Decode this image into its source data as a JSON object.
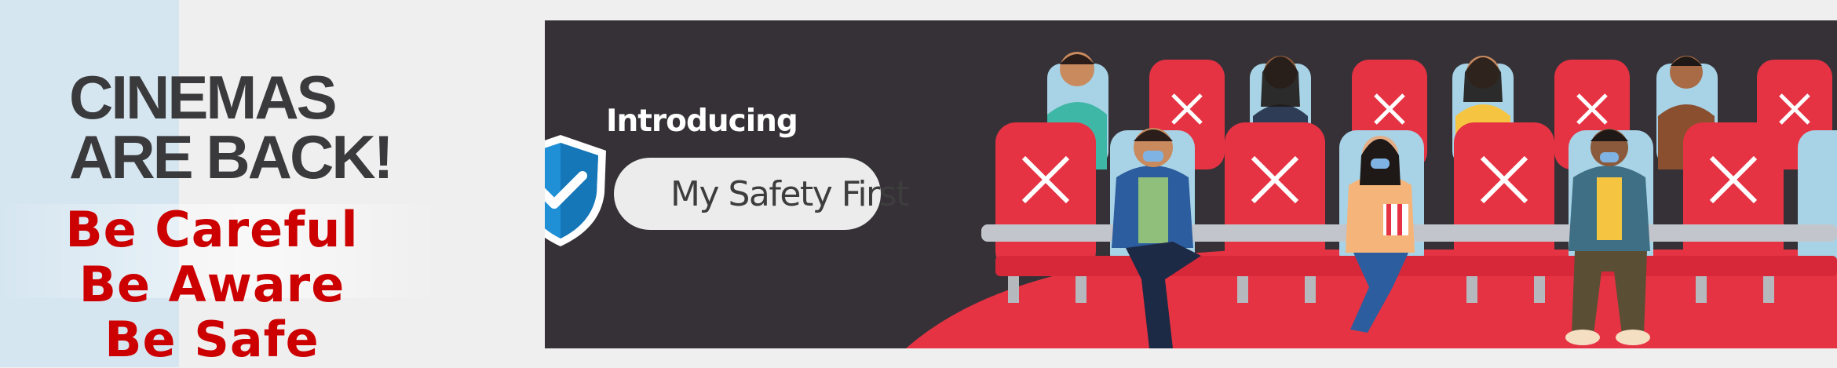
{
  "hero": {
    "headline_line1": "CINEMAS",
    "headline_line2": "ARE BACK!",
    "taglines": [
      "Be Careful",
      "Be Aware",
      "Be Safe"
    ]
  },
  "banner": {
    "intro_text": "Introducing",
    "feature_name": "My Safety First",
    "shield_icon": "shield-check-icon",
    "illustration": "cinema-audience-illustration"
  },
  "colors": {
    "tagline_red": "#cc0000",
    "banner_dark": "#353137",
    "seat_red": "#e53343",
    "seat_blue": "#a8d3e6",
    "shield_blue": "#1f8fd6"
  }
}
